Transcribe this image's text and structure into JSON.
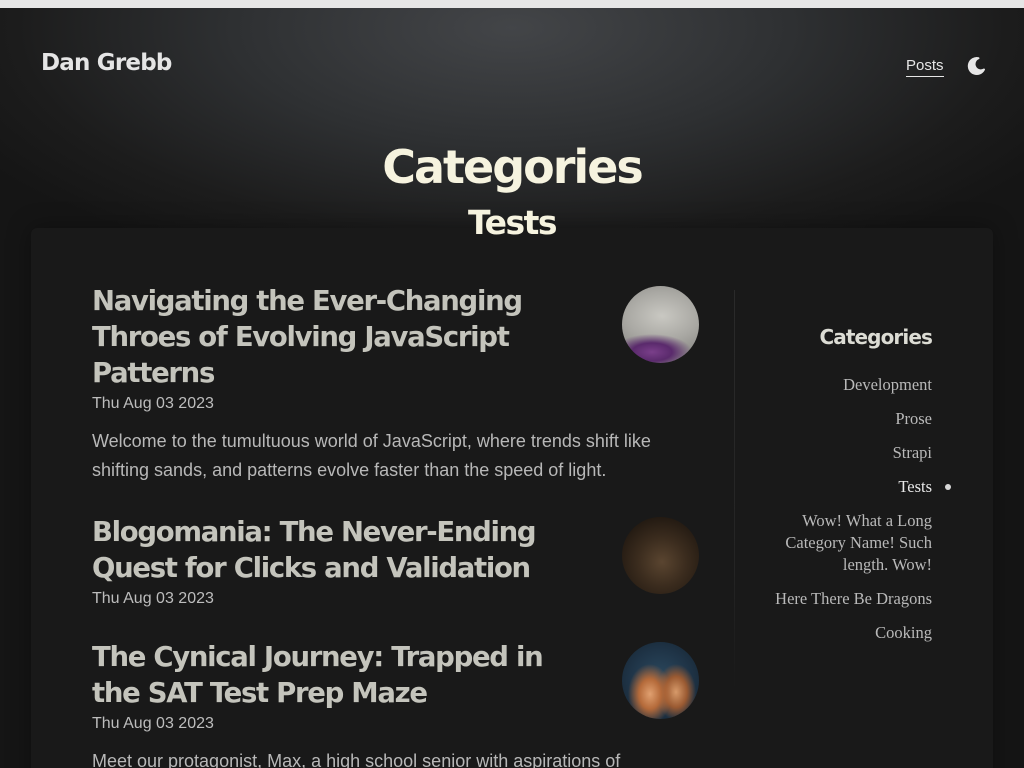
{
  "site": {
    "brand": "Dan Grebb",
    "nav": [
      {
        "label": "Posts",
        "active": true
      }
    ],
    "theme_toggle_icon": "moon-icon"
  },
  "hero": {
    "title": "Categories",
    "subtitle": "Tests"
  },
  "posts": [
    {
      "title": "Navigating the Ever-Changing Throes of Evolving JavaScript Patterns",
      "date": "Thu Aug 03 2023",
      "excerpt": "Welcome to the tumultuous world of JavaScript, where trends shift like shifting sands, and patterns evolve faster than the speed of light."
    },
    {
      "title": "Blogomania: The Never-Ending Quest for Clicks and Validation",
      "date": "Thu Aug 03 2023",
      "excerpt": ""
    },
    {
      "title": "The Cynical Journey: Trapped in the SAT Test Prep Maze",
      "date": "Thu Aug 03 2023",
      "excerpt": "Meet our protagonist, Max, a high school senior with aspirations of"
    }
  ],
  "sidebar": {
    "heading": "Categories",
    "categories": [
      {
        "label": "Development",
        "active": false
      },
      {
        "label": "Prose",
        "active": false
      },
      {
        "label": "Strapi",
        "active": false
      },
      {
        "label": "Tests",
        "active": true
      },
      {
        "label": "Wow! What a Long Category Name! Such length. Wow!",
        "active": false
      },
      {
        "label": "Here There Be Dragons",
        "active": false
      },
      {
        "label": "Cooking",
        "active": false
      }
    ]
  },
  "colors": {
    "background": "#141414",
    "card": "#191919",
    "heading": "#f6f3df",
    "post_title": "#c4c4bc"
  }
}
